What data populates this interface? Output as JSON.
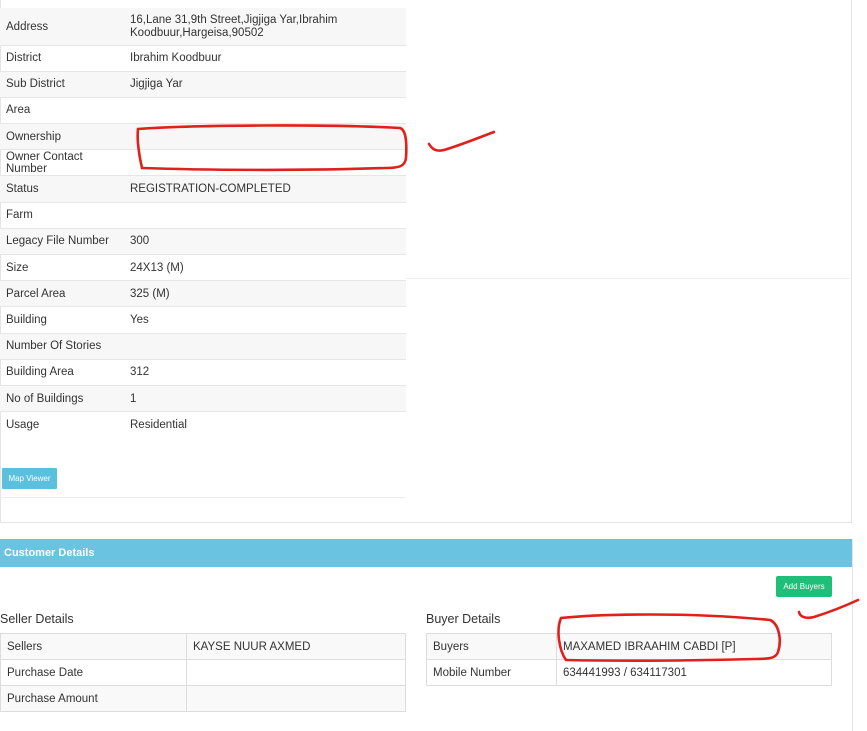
{
  "property_details": {
    "rows": [
      {
        "label": "Address",
        "value": "16,Lane 31,9th Street,Jigjiga Yar,Ibrahim Koodbuur,Hargeisa,90502"
      },
      {
        "label": "District",
        "value": "Ibrahim Koodbuur"
      },
      {
        "label": "Sub District",
        "value": "Jigjiga Yar"
      },
      {
        "label": "Area",
        "value": ""
      },
      {
        "label": "Ownership",
        "value": ""
      },
      {
        "label": "Owner Contact Number",
        "value": ""
      },
      {
        "label": "Status",
        "value": "REGISTRATION-COMPLETED"
      },
      {
        "label": "Farm",
        "value": ""
      },
      {
        "label": "Legacy File Number",
        "value": "300"
      },
      {
        "label": "Size",
        "value": "24X13 (M)"
      },
      {
        "label": "Parcel Area",
        "value": "325 (M)"
      },
      {
        "label": "Building",
        "value": "Yes"
      },
      {
        "label": "Number Of Stories",
        "value": ""
      },
      {
        "label": "Building Area",
        "value": "312"
      },
      {
        "label": "No of Buildings",
        "value": "1"
      },
      {
        "label": "Usage",
        "value": "Residential"
      }
    ],
    "map_viewer_label": "Map Viewer"
  },
  "customer_details": {
    "title": "Customer Details",
    "add_buyers_label": "Add Buyers",
    "seller": {
      "title": "Seller Details",
      "rows": [
        {
          "label": "Sellers",
          "value": "KAYSE NUUR AXMED"
        },
        {
          "label": "Purchase Date",
          "value": ""
        },
        {
          "label": "Purchase Amount",
          "value": ""
        }
      ]
    },
    "buyer": {
      "title": "Buyer Details",
      "rows": [
        {
          "label": "Buyers",
          "value": "MAXAMED IBRAAHIM CABDI [P]"
        },
        {
          "label": "Mobile Number",
          "value": "634441993 / 634117301"
        }
      ]
    }
  },
  "colors": {
    "header_blue": "#6ac3e0",
    "map_button": "#5bc0de",
    "add_button": "#1fbf7a",
    "annotation_red": "#e0201b"
  }
}
